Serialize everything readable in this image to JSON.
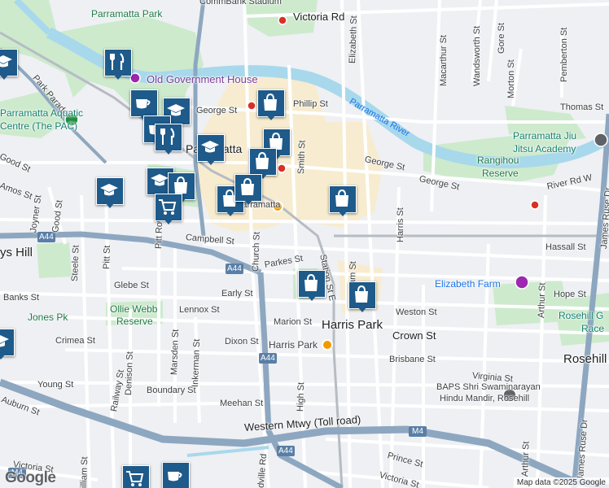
{
  "map": {
    "attribution": "Map data ©2025 Google",
    "logo_text": "Google",
    "colors": {
      "land": "#eef0f3",
      "park": "#cdeacd",
      "river": "#a8d8ec",
      "motorway": "#8ea7c0",
      "road": "#ffffff",
      "cbd": "#f7ecd0",
      "marker": "#1e5a8a"
    },
    "labels": {
      "parramatta_park": "Parramatta Park",
      "old_government_house": "Old Government House",
      "commbank_stadium": "CommBank Stadium",
      "victoria_rd": "Victoria Rd",
      "park_parade": "Park Parade",
      "aquatic_centre_1": "Parramatta Aquatic",
      "aquatic_centre_2": "Centre (The PAC)",
      "phillip_st": "Phillip St",
      "george_st_w": "George St",
      "george_st_e": "George St",
      "george_st_e2": "George St",
      "parramatta_center": "Parramatta",
      "parramatta_station": "Parramatta",
      "parramatta_river": "Parramatta River",
      "jiu_jitsu_1": "Parramatta Jiu",
      "jitsu_2": "Jitsu Academy",
      "rangihou_1": "Rangihou",
      "rangihou_2": "Reserve",
      "river_rd_w": "River Rd W",
      "thomas_st": "Thomas St",
      "macarthur_st": "Macarthur St",
      "elizabeth_st": "Elizabeth St",
      "wandsworth_st": "Wandsworth St",
      "gore_st": "Gore St",
      "morton_st": "Morton St",
      "pemberton_st": "Pemberton St",
      "harris_st": "Harris St",
      "smith_st": "Smith St",
      "church_st": "Church St",
      "campbell_st": "Campbell St",
      "parkes_st": "Parkes St",
      "station_st_e": "Station St E",
      "hassall_st": "Hassall St",
      "hope_st": "Hope St",
      "elizabeth_farm": "Elizabeth Farm",
      "rosehill_gardens_1": "Rosehill G",
      "rosehill_gardens_2": "Race",
      "arthur_st_n": "Arthur St",
      "arthur_st_s": "Arthur St",
      "james_ruse_dr_n": "James Ruse Dr",
      "james_ruse_dr_s": "James Ruse Dr",
      "weston_st": "Weston St",
      "crown_st": "Crown St",
      "brisbane_st": "Brisbane St",
      "virginia_st": "Virginia St",
      "rosehill": "Rosehill",
      "harris_park": "Harris Park",
      "harris_park_station": "Harris Park",
      "marion_st": "Marion St",
      "dixon_st": "Dixon St",
      "early_st": "Early St",
      "lennox_st": "Lennox St",
      "glebe_st": "Glebe St",
      "banks_st": "Banks St",
      "harris_hill": "ys Hill",
      "jones_pk": "Jones Pk",
      "ollie_webb_1": "Ollie Webb",
      "ollie_webb_2": "Reserve",
      "crimea_st": "Crimea St",
      "young_st": "Young St",
      "auburn_st": "Auburn St",
      "boundary_st": "Boundary St",
      "meehan_st": "Meehan St",
      "high_st": "High St",
      "western_mtwy": "Western Mtwy (Toll road)",
      "baps_1": "BAPS Shri Swaminarayan",
      "baps_2": "Hindu Mandir, Rosehill",
      "prince_st": "Prince St",
      "victoria_st_se": "Victoria St",
      "victoria_st_sw": "Victoria St",
      "william_st": "illiam St",
      "pitt_st": "Pitt St",
      "steele_st": "Steele St",
      "good_st_n": "Good St",
      "good_st_s": "Good St",
      "joyner_st": "Joyner St",
      "amos_st": "Amos St",
      "pitt_row": "Pitt Row",
      "denison_st": "Denison St",
      "marsden_st": "Marsden St",
      "inkerman_st": "Inkerman St",
      "railway_st": "Railway St",
      "woodville_rd": "odville Rd",
      "a44_w": "A44",
      "a44_c": "A44",
      "a44_s": "A44",
      "a44_se": "A44",
      "m4_e": "M4",
      "m4_c": "M4",
      "m4_w": "M4"
    },
    "markers": [
      {
        "name": "education-marker-nw",
        "icon": "graduation-cap-icon"
      },
      {
        "name": "restaurant-marker-park",
        "icon": "fork-knife-icon"
      },
      {
        "name": "cafe-marker-george",
        "icon": "coffee-cup-icon"
      },
      {
        "name": "education-marker-george",
        "icon": "graduation-cap-icon"
      },
      {
        "name": "cafe-marker-church",
        "icon": "coffee-cup-icon"
      },
      {
        "name": "restaurant-marker-church",
        "icon": "fork-knife-icon"
      },
      {
        "name": "education-marker-church",
        "icon": "graduation-cap-icon"
      },
      {
        "name": "shopping-marker-phillip",
        "icon": "shopping-bag-icon"
      },
      {
        "name": "shopping-marker-smith",
        "icon": "shopping-bag-icon"
      },
      {
        "name": "shopping-marker-centre",
        "icon": "shopping-bag-icon"
      },
      {
        "name": "education-marker-west",
        "icon": "graduation-cap-icon"
      },
      {
        "name": "education-marker-macquarie",
        "icon": "graduation-cap-icon"
      },
      {
        "name": "shopping-marker-macquarie",
        "icon": "shopping-bag-icon"
      },
      {
        "name": "grocery-marker",
        "icon": "shopping-cart-icon"
      },
      {
        "name": "shopping-marker-station-1",
        "icon": "shopping-bag-icon"
      },
      {
        "name": "shopping-marker-station-2",
        "icon": "shopping-bag-icon"
      },
      {
        "name": "shopping-marker-east",
        "icon": "shopping-bag-icon"
      },
      {
        "name": "shopping-marker-parkes",
        "icon": "shopping-bag-icon"
      },
      {
        "name": "shopping-marker-harris-park",
        "icon": "shopping-bag-icon"
      },
      {
        "name": "education-marker-sw",
        "icon": "graduation-cap-icon"
      },
      {
        "name": "grocery-marker-south",
        "icon": "shopping-cart-icon"
      },
      {
        "name": "cafe-marker-south",
        "icon": "coffee-cup-icon"
      }
    ]
  }
}
